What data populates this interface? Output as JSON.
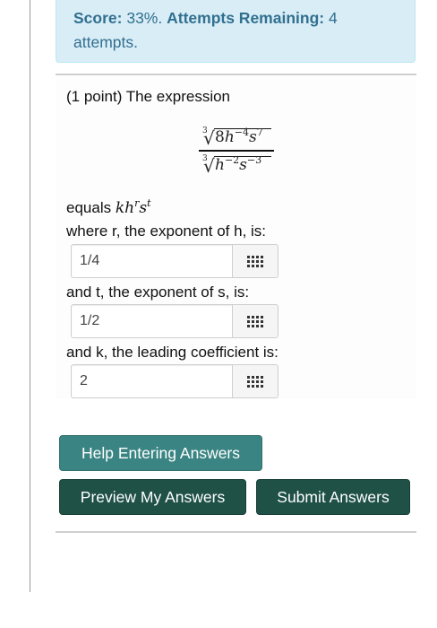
{
  "score_box": {
    "score_label": "Score:",
    "score_value": "33%.",
    "attempts_label": "Attempts Remaining:",
    "attempts_value": "4",
    "attempts_unit": "attempts."
  },
  "problem": {
    "intro": "(1 point) The expression",
    "numerator_index": "3",
    "numerator_coef": "8",
    "numerator_var1": "h",
    "numerator_exp1": "−4",
    "numerator_var2": "s",
    "numerator_exp2": "7",
    "denominator_index": "3",
    "denominator_var1": "h",
    "denominator_exp1": "−2",
    "denominator_var2": "s",
    "denominator_exp2": "−3",
    "equals_text": "equals",
    "form_k": "k",
    "form_h": "h",
    "form_r": "r",
    "form_s": "s",
    "form_t": "t",
    "q1": "where r, the exponent of h, is:",
    "a1": "1/4",
    "q2": "and t, the exponent of s, is:",
    "a2": "1/2",
    "q3": "and k, the leading coefficient is:",
    "a3": "2"
  },
  "icons": {
    "equation_editor": "grid-icon"
  },
  "buttons": {
    "help": "Help Entering Answers",
    "preview": "Preview My Answers",
    "submit": "Submit Answers"
  },
  "colors": {
    "alert_bg": "#d9edf7",
    "alert_text": "#31708f",
    "help_button": "#3a8583",
    "primary_button": "#1f5147"
  }
}
